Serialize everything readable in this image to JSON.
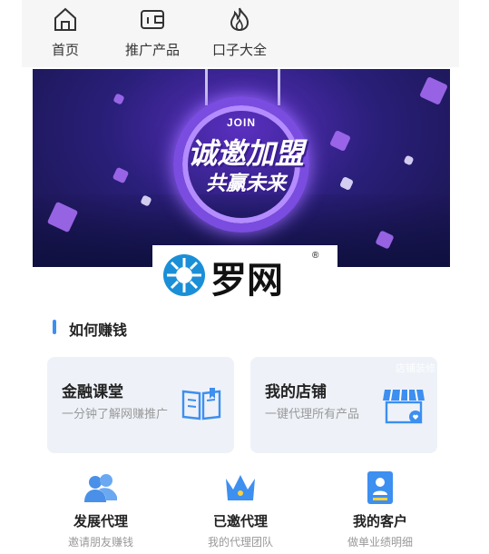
{
  "nav": {
    "items": [
      {
        "label": "首页",
        "icon": "home-icon"
      },
      {
        "label": "推广产品",
        "icon": "wallet-icon"
      },
      {
        "label": "口子大全",
        "icon": "fire-icon"
      }
    ]
  },
  "banner": {
    "top_text": "JOIN",
    "main_text": "诚邀加盟",
    "sub_text": "共赢未来"
  },
  "watermark": {
    "text": "罗网",
    "reg": "®"
  },
  "section": {
    "title": "如何赚钱"
  },
  "cards": [
    {
      "title": "金融课堂",
      "subtitle": "一分钟了解网赚推广",
      "icon": "book-icon"
    },
    {
      "title": "我的店铺",
      "subtitle": "一键代理所有产品",
      "icon": "store-icon",
      "corner": "店铺装修"
    }
  ],
  "bottom": [
    {
      "title": "发展代理",
      "subtitle": "邀请朋友赚钱",
      "icon": "users-icon"
    },
    {
      "title": "已邀代理",
      "subtitle": "我的代理团队",
      "icon": "crown-icon"
    },
    {
      "title": "我的客户",
      "subtitle": "做单业绩明细",
      "icon": "id-card-icon"
    }
  ],
  "colors": {
    "accent": "#3d8ff0",
    "card_bg": "#eef2f8"
  }
}
